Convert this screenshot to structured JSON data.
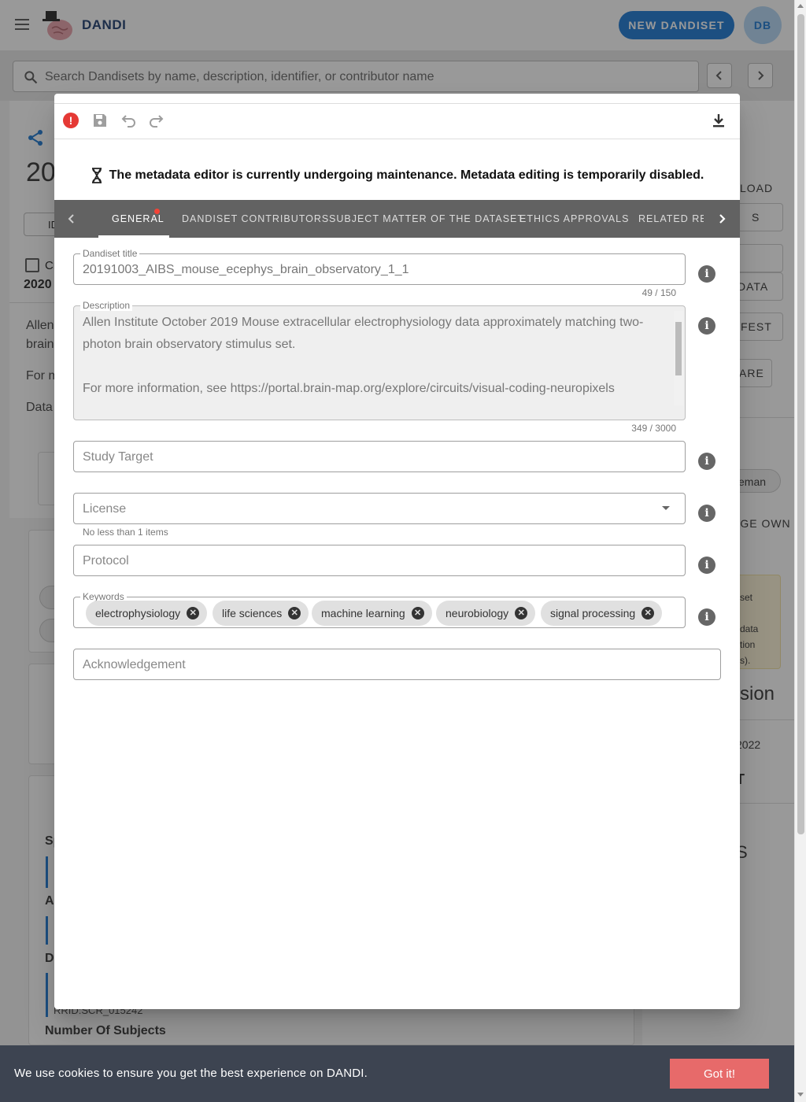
{
  "app": {
    "brand": "DANDI",
    "new_button": "NEW DANDISET",
    "avatar": "DB",
    "search_placeholder": "Search Dandisets by name, description, identifier, or contributor name"
  },
  "background": {
    "title_prefix": "20",
    "id_chip": "ID",
    "created_label": "Cr",
    "created_year": "2020",
    "text_lines": [
      "Allen",
      "brain",
      "For m",
      "Data"
    ],
    "section_headers": [
      "Sp",
      "A",
      "Da",
      "Number Of Subjects"
    ],
    "rrid_fragment": "RRID:SCR_015242",
    "right_panel": {
      "download": "LOAD",
      "files": "S",
      "metadata": "DATA",
      "manifest": "FEST",
      "share": "ARE",
      "contributor": "keman",
      "manage": "AGE OWN",
      "notice": [
        "set",
        "data",
        "tion",
        "s)."
      ],
      "version_heading": "rsion",
      "version_date": "2022",
      "version_label": "T",
      "other_heading": "S"
    }
  },
  "dialog": {
    "banner": "The metadata editor is currently undergoing maintenance. Metadata editing is temporarily disabled.",
    "tabs": [
      {
        "label": "GENERAL",
        "active": true,
        "has_error": true
      },
      {
        "label": "DANDISET CONTRIBUTORS"
      },
      {
        "label": "SUBJECT MATTER OF THE DATASET"
      },
      {
        "label": "ETHICS APPROVALS"
      },
      {
        "label": "RELATED RESOURCES"
      }
    ],
    "fields": {
      "title": {
        "label": "Dandiset title",
        "value": "20191003_AIBS_mouse_ecephys_brain_observatory_1_1",
        "counter": "49 / 150"
      },
      "description": {
        "label": "Description",
        "value": "Allen Institute October 2019 Mouse extracellular electrophysiology data approximately matching two-photon brain observatory stimulus set.\n\nFor more information, see https://portal.brain-map.org/explore/circuits/visual-coding-neuropixels",
        "counter": "349 / 3000"
      },
      "study_target": {
        "placeholder": "Study Target"
      },
      "license": {
        "placeholder": "License",
        "hint": "No less than 1 items"
      },
      "protocol": {
        "placeholder": "Protocol"
      },
      "keywords": {
        "label": "Keywords",
        "items": [
          "electrophysiology",
          "life sciences",
          "machine learning",
          "neurobiology",
          "signal processing"
        ]
      },
      "acknowledgement": {
        "placeholder": "Acknowledgement"
      }
    },
    "icons": [
      "error-icon",
      "save-icon",
      "undo-icon",
      "redo-icon",
      "download-icon",
      "hourglass-icon"
    ]
  },
  "cookie": {
    "text": "We use cookies to ensure you get the best experience on DANDI.",
    "button": "Got it!"
  },
  "colors": {
    "primary": "#1976d2",
    "tabs_bg": "#626262",
    "error": "#e53935",
    "cookie_bg": "#3d4451",
    "cookie_button": "#e76a6a"
  }
}
